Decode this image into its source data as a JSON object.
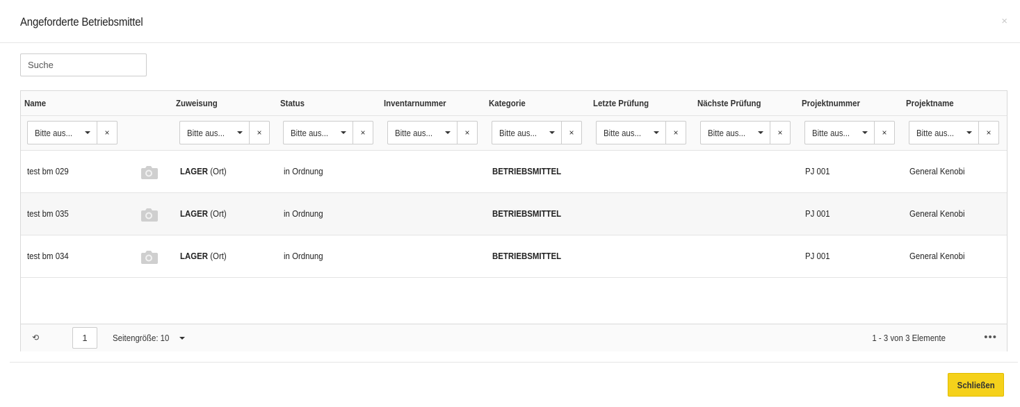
{
  "modal": {
    "title": "Angeforderte Betriebsmittel",
    "close_icon": "×"
  },
  "search": {
    "placeholder": "Suche"
  },
  "grid": {
    "columns": [
      {
        "label": "Name"
      },
      {
        "label": "Zuweisung"
      },
      {
        "label": "Status"
      },
      {
        "label": "Inventarnummer"
      },
      {
        "label": "Kategorie"
      },
      {
        "label": "Letzte Prüfung"
      },
      {
        "label": "Nächste Prüfung"
      },
      {
        "label": "Projektnummer"
      },
      {
        "label": "Projektname"
      }
    ],
    "filter_placeholder": "Bitte aus...",
    "filter_clear": "×",
    "rows": [
      {
        "name": "test bm 029",
        "zuweisung_bold": "LAGER",
        "zuweisung_suffix": "(Ort)",
        "status": "in Ordnung",
        "inventarnummer": "",
        "kategorie": "BETRIEBSMITTEL",
        "letzte_pruefung": "",
        "naechste_pruefung": "",
        "projektnummer": "PJ 001",
        "projektname": "General Kenobi"
      },
      {
        "name": "test bm 035",
        "zuweisung_bold": "LAGER",
        "zuweisung_suffix": "(Ort)",
        "status": "in Ordnung",
        "inventarnummer": "",
        "kategorie": "BETRIEBSMITTEL",
        "letzte_pruefung": "",
        "naechste_pruefung": "",
        "projektnummer": "PJ 001",
        "projektname": "General Kenobi"
      },
      {
        "name": "test bm 034",
        "zuweisung_bold": "LAGER",
        "zuweisung_suffix": "(Ort)",
        "status": "in Ordnung",
        "inventarnummer": "",
        "kategorie": "BETRIEBSMITTEL",
        "letzte_pruefung": "",
        "naechste_pruefung": "",
        "projektnummer": "PJ 001",
        "projektname": "General Kenobi"
      }
    ],
    "row_icon": "camera-icon"
  },
  "pager": {
    "refresh_icon": "⟲",
    "current_page": "1",
    "page_size_label": "Seitengröße: 10",
    "info": "1 - 3 von 3 Elemente",
    "more_icon": "•••"
  },
  "footer": {
    "close_label": "Schließen",
    "accent_color": "#f5d11b"
  }
}
